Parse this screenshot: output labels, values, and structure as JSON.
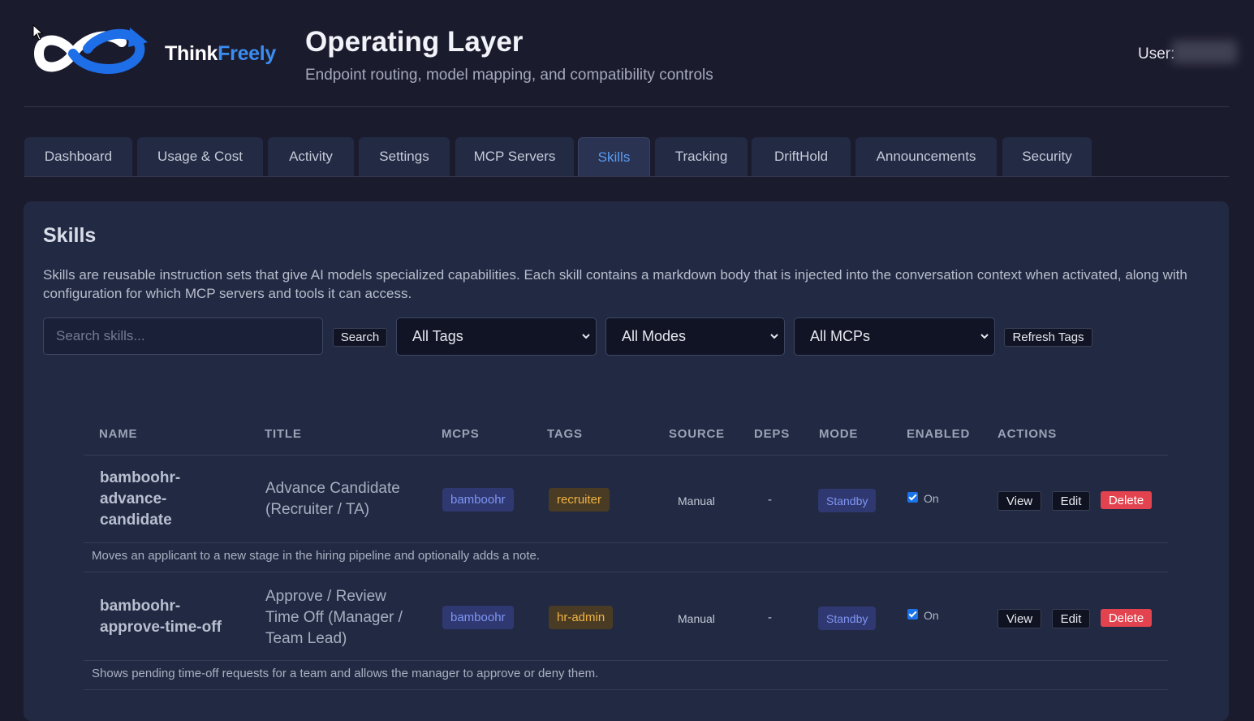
{
  "header": {
    "brand_part1": "Think",
    "brand_part2": "Freely",
    "title": "Operating Layer",
    "subtitle": "Endpoint routing, model mapping, and compatibility controls",
    "user_label": "User:"
  },
  "tabs": [
    {
      "label": "Dashboard"
    },
    {
      "label": "Usage & Cost"
    },
    {
      "label": "Activity"
    },
    {
      "label": "Settings"
    },
    {
      "label": "MCP Servers"
    },
    {
      "label": "Skills",
      "active": true
    },
    {
      "label": "Tracking"
    },
    {
      "label": "DriftHold"
    },
    {
      "label": "Announcements"
    },
    {
      "label": "Security"
    }
  ],
  "skills": {
    "title": "Skills",
    "description": "Skills are reusable instruction sets that give AI models specialized capabilities. Each skill contains a markdown body that is injected into the conversation context when activated, along with configuration for which MCP servers and tools it can access.",
    "search_placeholder": "Search skills...",
    "search_button": "Search",
    "tag_filter": "All Tags",
    "mode_filter": "All Modes",
    "mcp_filter": "All MCPs",
    "refresh_button": "Refresh Tags"
  },
  "table": {
    "columns": [
      "NAME",
      "TITLE",
      "MCPS",
      "TAGS",
      "SOURCE",
      "DEPS",
      "MODE",
      "ENABLED",
      "ACTIONS"
    ],
    "rows": [
      {
        "name_lines": [
          "bamboohr-",
          "advance-",
          "candidate"
        ],
        "title_lines": [
          "Advance Candidate",
          "(Recruiter / TA)"
        ],
        "mcp": "bamboohr",
        "tag": "recruiter",
        "source": "Manual",
        "deps": "-",
        "mode": "Standby",
        "enabled": true,
        "enabled_label": "On",
        "description": "Moves an applicant to a new stage in the hiring pipeline and optionally adds a note."
      },
      {
        "name_lines": [
          "bamboohr-",
          "approve-time-off"
        ],
        "title_lines": [
          "Approve / Review",
          "Time Off (Manager /",
          "Team Lead)"
        ],
        "mcp": "bamboohr",
        "tag": "hr-admin",
        "source": "Manual",
        "deps": "-",
        "mode": "Standby",
        "enabled": true,
        "enabled_label": "On",
        "description": "Shows pending time-off requests for a team and allows the manager to approve or deny them."
      }
    ],
    "actions": {
      "view": "View",
      "edit": "Edit",
      "delete": "Delete"
    }
  },
  "colors": {
    "background": "#1b1b2e",
    "panel": "#222a43",
    "accent": "#5a9cf3",
    "delete": "#e2434f",
    "tag_text": "#f1b443",
    "mcp_text": "#7f95f2"
  }
}
